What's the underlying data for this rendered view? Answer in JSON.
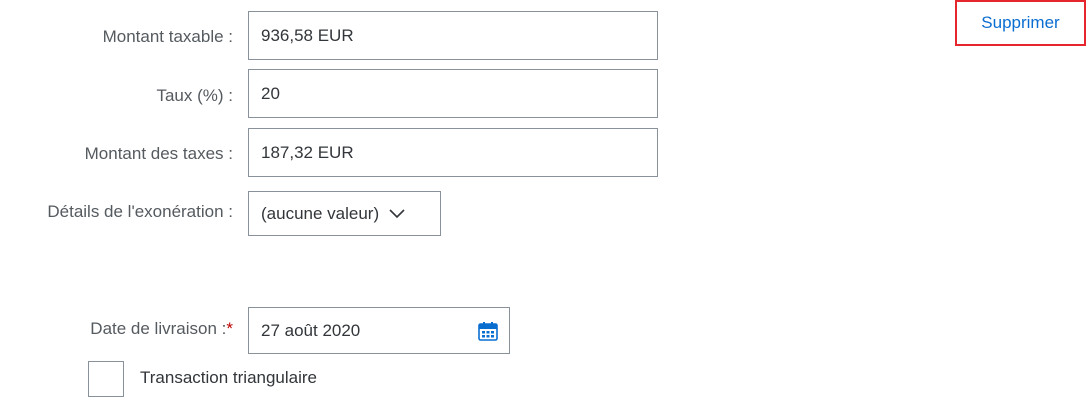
{
  "actions": {
    "delete_label": "Supprimer",
    "delete_color": "#0a6ed1",
    "highlight_color": "#e6262d"
  },
  "taxable_amount": {
    "label": "Montant taxable :",
    "value": "936,58 EUR"
  },
  "rate": {
    "label": "Taux (%) :",
    "value": "20"
  },
  "tax_amount": {
    "label": "Montant des taxes :",
    "value": "187,32 EUR"
  },
  "exemption": {
    "label": "Détails de l'exonération :",
    "selected": "(aucune valeur)",
    "icon": "chevron-down-icon"
  },
  "delivery_date": {
    "label": "Date de livraison :",
    "required_mark": "*",
    "value": "27 août 2020",
    "icon": "calendar-icon"
  },
  "triangular": {
    "label": "Transaction triangulaire",
    "checked": false
  }
}
